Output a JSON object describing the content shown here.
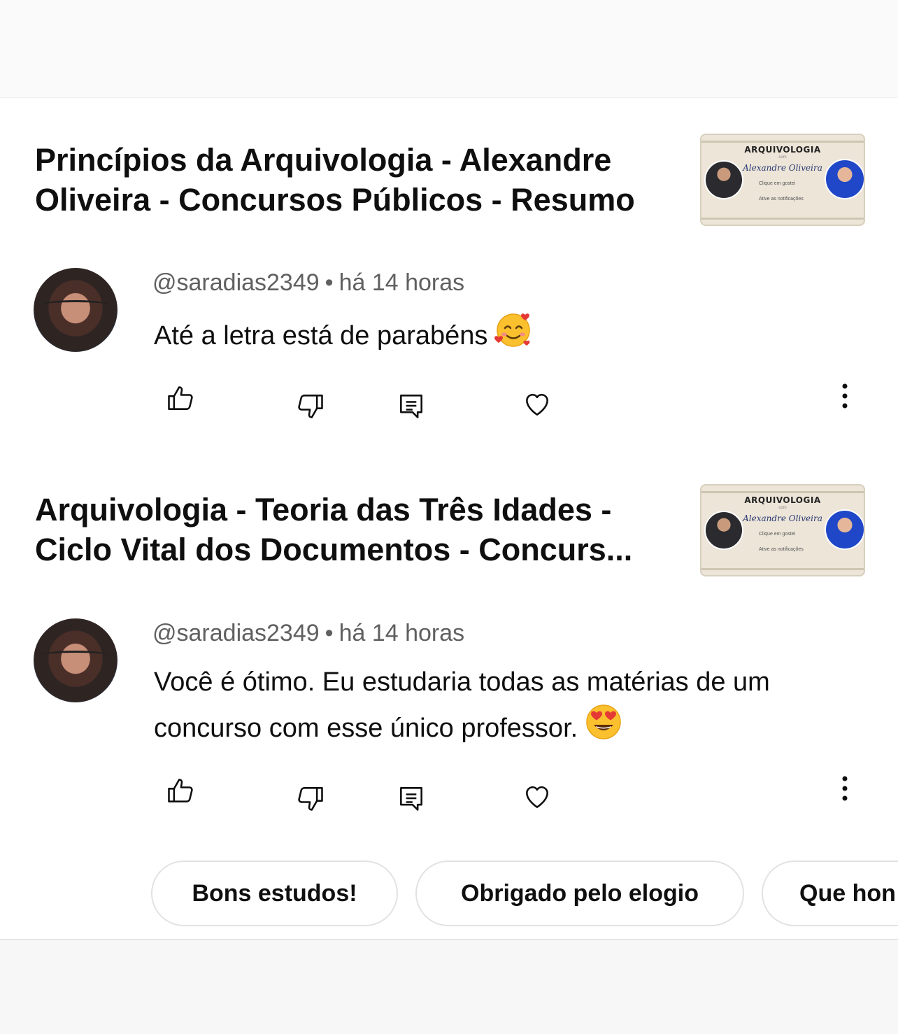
{
  "comments": [
    {
      "video_title": "Princípios da Arquivologia - Alexandre Oliveira - Concursos Públicos - Resumo",
      "thumbnail": {
        "title": "ARQUIVOLOGIA",
        "com": "com",
        "name": "Alexandre Oliveira",
        "like_text": "Clique em gostei",
        "bell_text": "Ative as notificações"
      },
      "author": "@saradias2349",
      "separator": "•",
      "time": "há 14 horas",
      "text": "Até a letra está de parabéns",
      "emoji": "smiling-face-with-hearts"
    },
    {
      "video_title": "Arquivologia - Teoria das Três Idades - Ciclo Vital dos Documentos - Concurs...",
      "thumbnail": {
        "title": "ARQUIVOLOGIA",
        "com": "com",
        "name": "Alexandre Oliveira",
        "like_text": "Clique em gostei",
        "bell_text": "Ative as notificações"
      },
      "author": "@saradias2349",
      "separator": "•",
      "time": "há 14 horas",
      "text": "Você é ótimo. Eu estudaria todas as matérias de um concurso com esse único professor.",
      "emoji": "heart-eyes"
    }
  ],
  "suggested_replies": [
    "Bons estudos!",
    "Obrigado pelo elogio",
    "Que hon"
  ],
  "icons": [
    "thumbs-up-icon",
    "thumbs-down-icon",
    "reply-icon",
    "heart-icon",
    "more-vert-icon"
  ],
  "colors": {
    "text": "#0f0f0f",
    "meta": "#606060",
    "chip_border": "#e2e2e2"
  }
}
